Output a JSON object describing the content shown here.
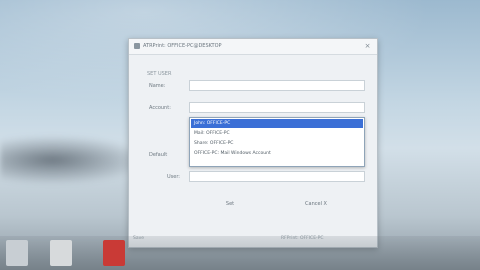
{
  "dialog": {
    "title": "ATRPrint: OFFICE-PC@DESKTOP",
    "close_glyph": "×",
    "group_label": "SET USER",
    "fields": {
      "name_label": "Name:",
      "account_label": "Account:",
      "default_label": "Default",
      "user_label": "User:"
    },
    "account_options": [
      {
        "label": "John: OFFICE-PC",
        "selected": true
      },
      {
        "label": "Mail: OFFICE-PC",
        "selected": false
      },
      {
        "label": "Share: OFFICE-PC",
        "selected": false
      },
      {
        "label": "OFFICE-PC: Mail Windows Account",
        "selected": false
      }
    ],
    "buttons": {
      "ok": "Set",
      "cancel": "Cancel X"
    },
    "footer": {
      "left": "Save",
      "right": "RFPrint: OFFICE-PC"
    }
  },
  "taskbar": {
    "icons": [
      {
        "name": "file-icon",
        "color": "#c8ced3"
      },
      {
        "name": "folder-icon",
        "color": "#d7dadc"
      },
      {
        "name": "app-icon",
        "color": "#c93a36"
      }
    ]
  }
}
